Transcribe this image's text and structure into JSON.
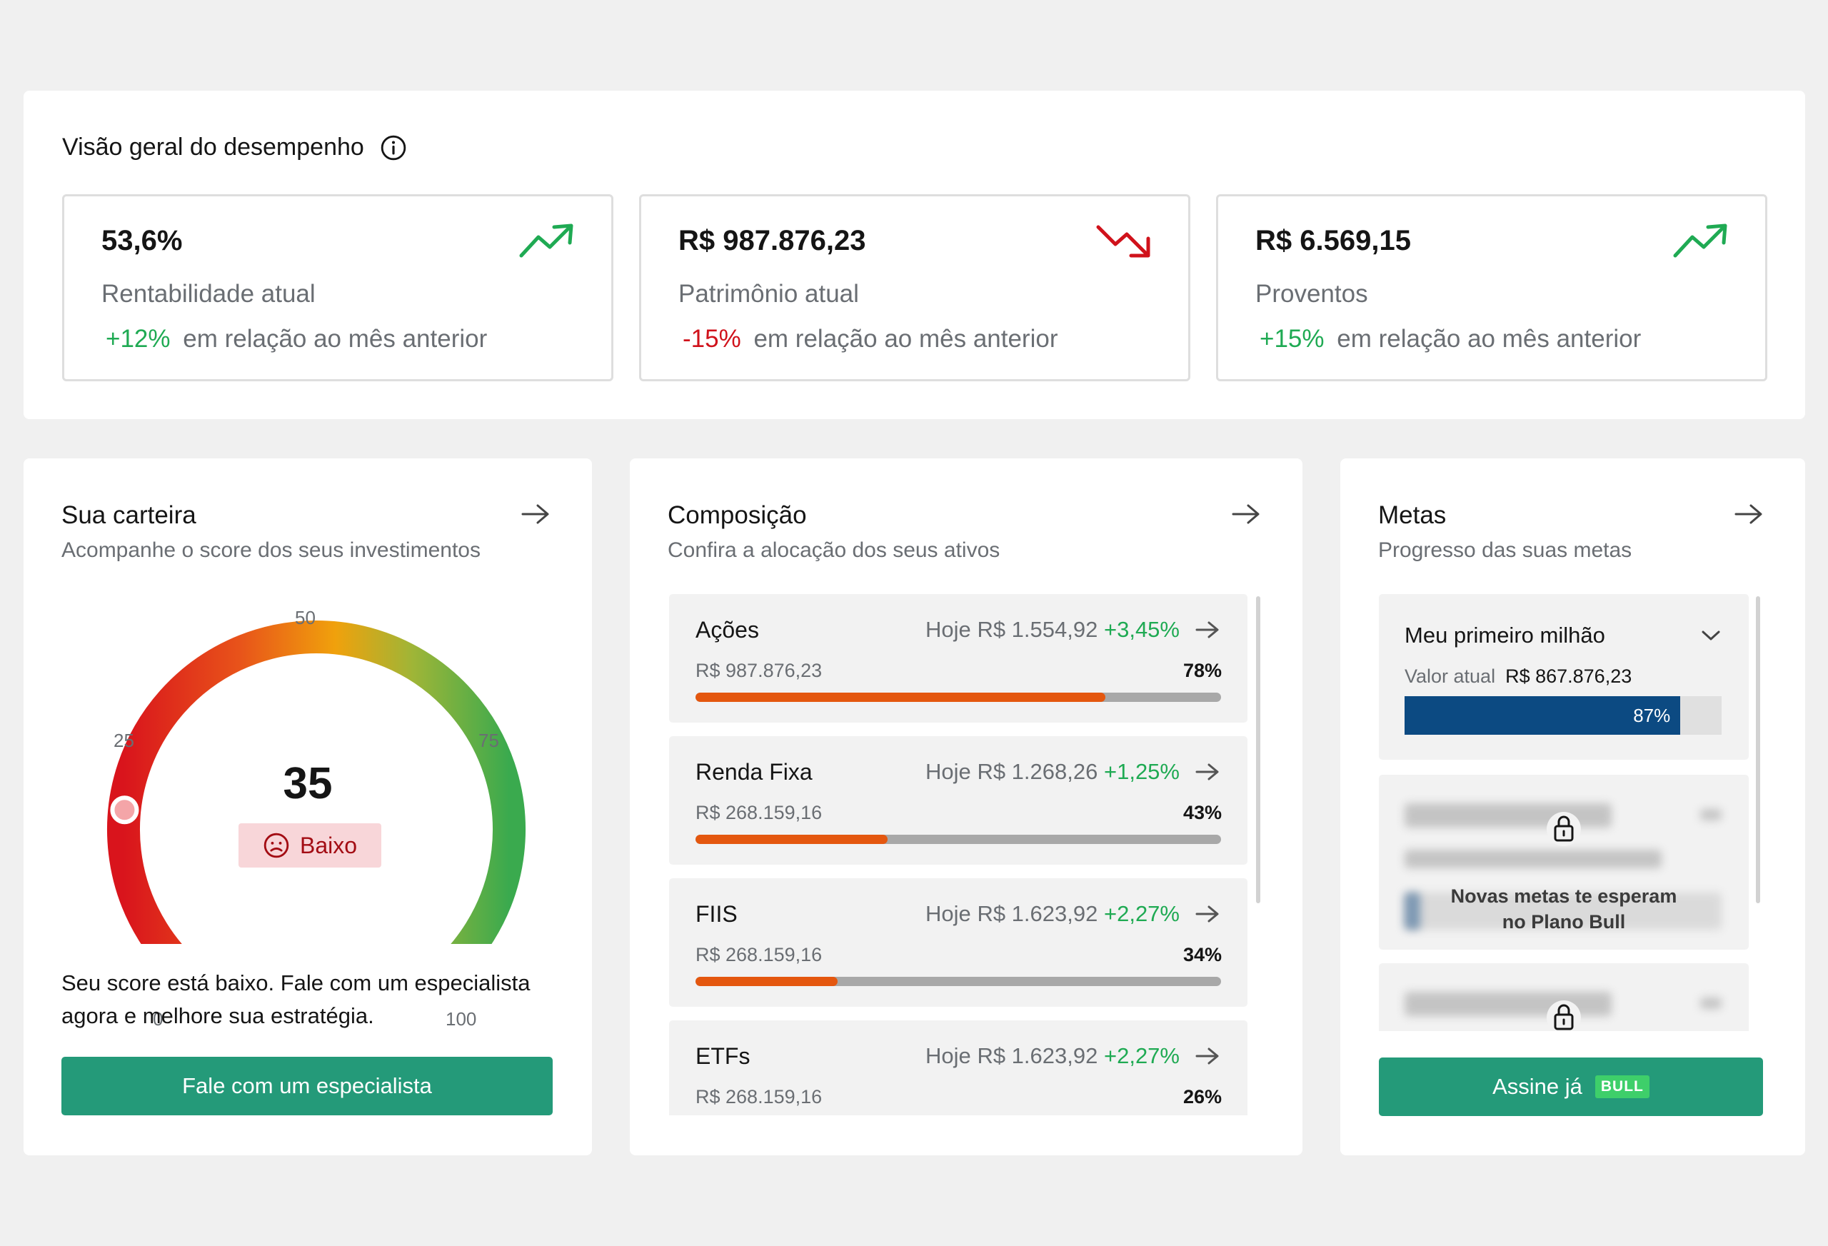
{
  "overview": {
    "title": "Visão geral do desempenho",
    "kpis": [
      {
        "value": "53,6%",
        "label": "Rentabilidade atual",
        "delta": "+12%",
        "delta_text": "em relação ao mês anterior",
        "trend": "up"
      },
      {
        "value": "R$ 987.876,23",
        "label": "Patrimônio atual",
        "delta": "-15%",
        "delta_text": "em relação ao mês anterior",
        "trend": "down"
      },
      {
        "value": "R$ 6.569,15",
        "label": "Proventos",
        "delta": "+15%",
        "delta_text": "em relação ao mês anterior",
        "trend": "up"
      }
    ]
  },
  "wallet": {
    "title": "Sua carteira",
    "subtitle": "Acompanhe o score dos seus investimentos",
    "gauge": {
      "min_label": "0",
      "q1_label": "25",
      "mid_label": "50",
      "q3_label": "75",
      "max_label": "100",
      "min": 0,
      "max": 100,
      "score": 35,
      "score_text": "35",
      "status": "Baixo",
      "indicator_value": 21
    },
    "message": "Seu score está baixo. Fale com um especialista agora e melhore sua estratégia.",
    "button": "Fale com um especialista"
  },
  "composition": {
    "title": "Composição",
    "subtitle": "Confira a alocação dos seus ativos",
    "items": [
      {
        "name": "Ações",
        "today_label": "Hoje",
        "today_value": "R$ 1.554,92",
        "change": "+3,45%",
        "amount": "R$ 987.876,23",
        "percent": "78%",
        "fraction": 0.78
      },
      {
        "name": "Renda Fixa",
        "today_label": "Hoje",
        "today_value": "R$ 1.268,26",
        "change": "+1,25%",
        "amount": "R$ 268.159,16",
        "percent": "43%",
        "fraction": 0.365
      },
      {
        "name": "FIIS",
        "today_label": "Hoje",
        "today_value": "R$ 1.623,92",
        "change": "+2,27%",
        "amount": "R$ 268.159,16",
        "percent": "34%",
        "fraction": 0.27
      },
      {
        "name": "ETFs",
        "today_label": "Hoje",
        "today_value": "R$ 1.623,92",
        "change": "+2,27%",
        "amount": "R$ 268.159,16",
        "percent": "26%",
        "fraction": 0.26
      }
    ]
  },
  "goals": {
    "title": "Metas",
    "subtitle": "Progresso das suas metas",
    "items": [
      {
        "name": "Meu primeiro milhão",
        "current_label": "Valor atual",
        "current_value": "R$ 867.876,23",
        "percent": "87%",
        "fraction": 0.87
      }
    ],
    "locked_message_line1": "Novas metas te esperam",
    "locked_message_line2": "no Plano Bull",
    "button": "Assine já",
    "button_badge": "BULL"
  },
  "colors": {
    "positive": "#1faa53",
    "negative": "#d0121b",
    "primary_button": "#249a79",
    "progress_orange": "#e4570f",
    "goal_blue": "#0c4a82"
  }
}
